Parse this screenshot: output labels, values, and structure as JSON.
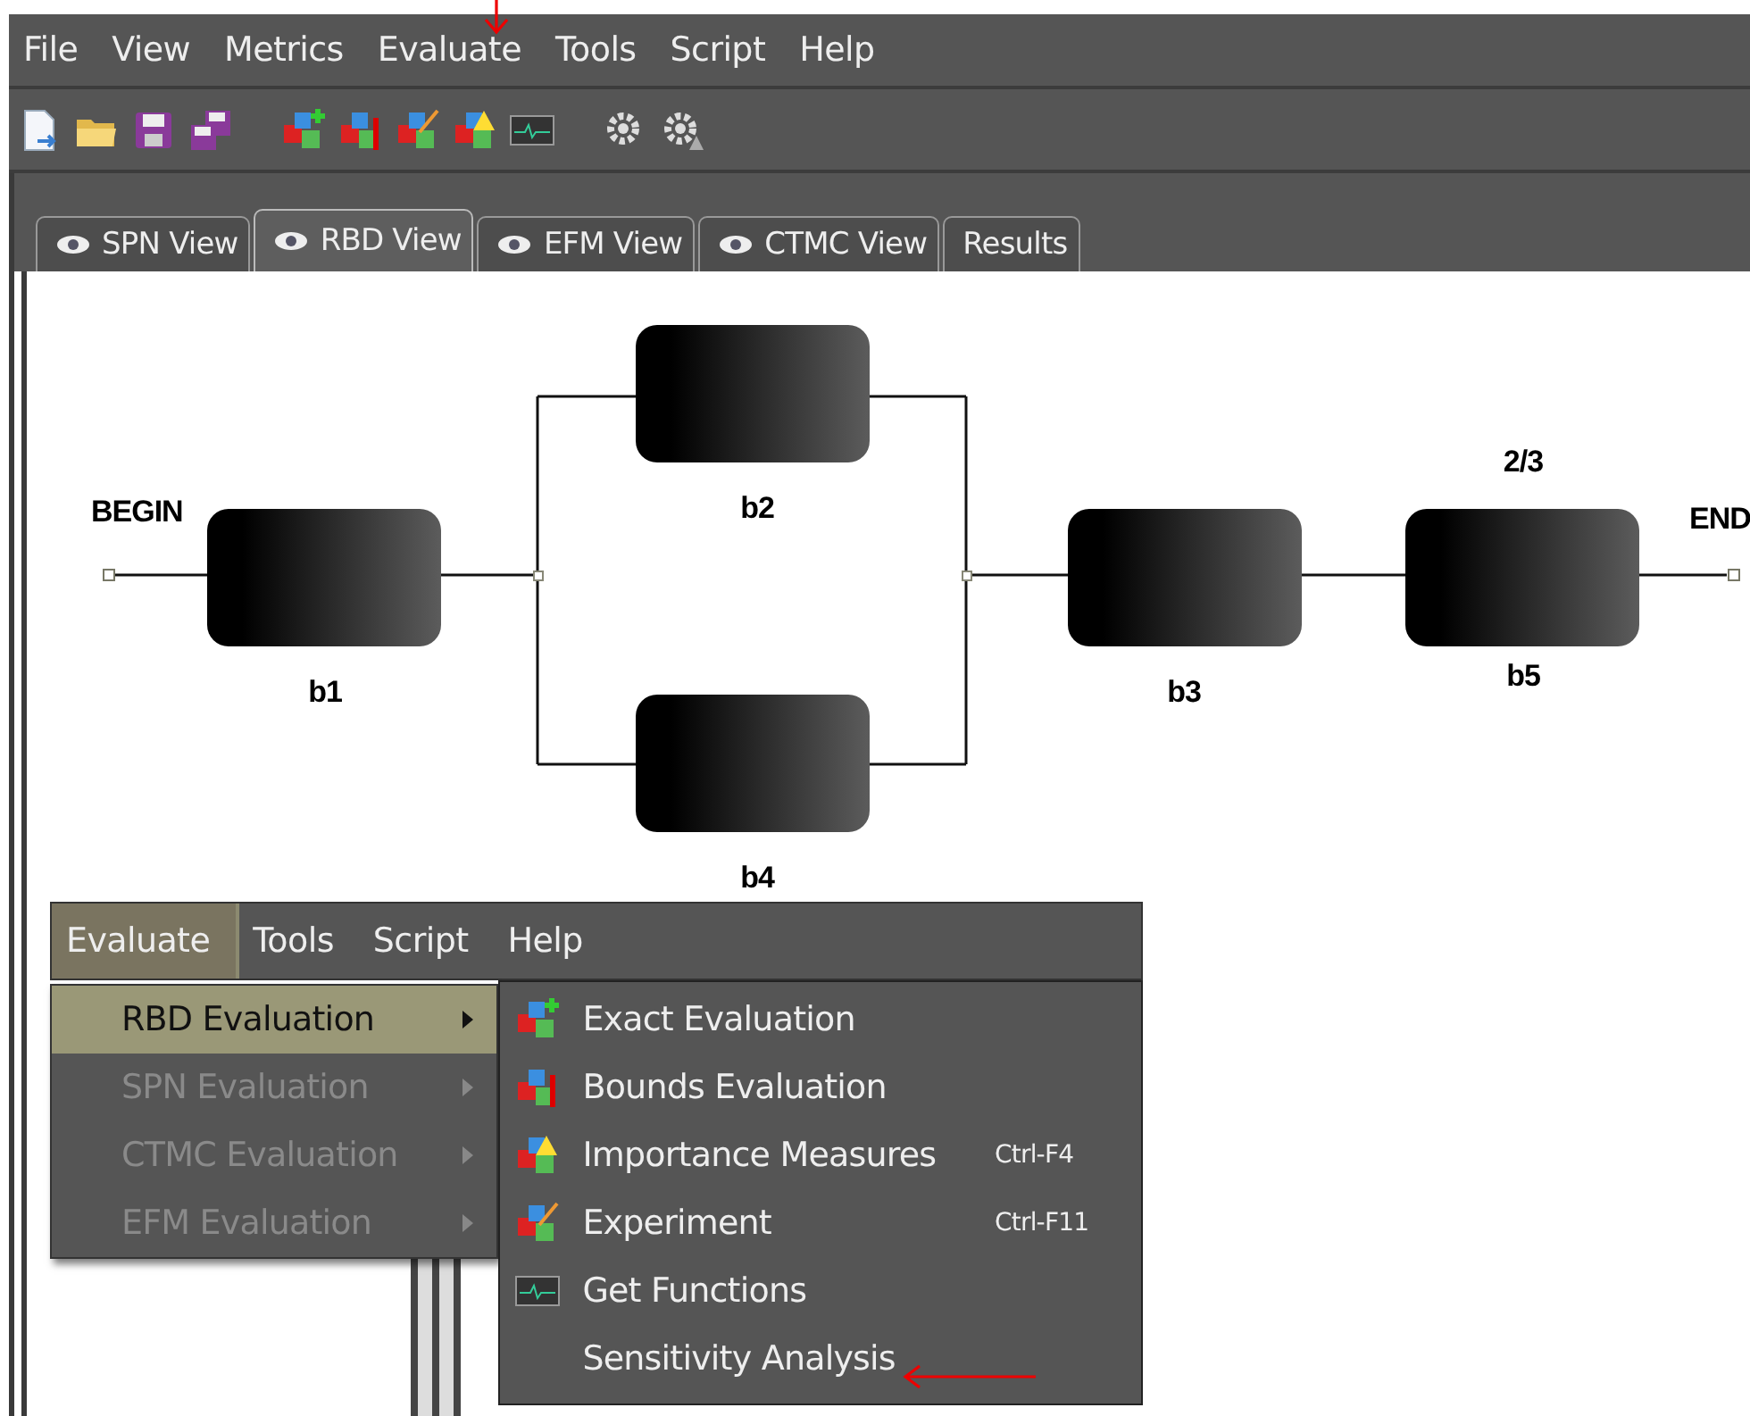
{
  "menu_bar": [
    {
      "label": "File"
    },
    {
      "label": "View"
    },
    {
      "label": "Metrics"
    },
    {
      "label": "Evaluate"
    },
    {
      "label": "Tools"
    },
    {
      "label": "Script"
    },
    {
      "label": "Help"
    }
  ],
  "tabs": [
    {
      "label": "SPN View",
      "selected": false,
      "eye": true
    },
    {
      "label": "RBD View",
      "selected": true,
      "eye": true
    },
    {
      "label": "EFM View",
      "selected": false,
      "eye": true
    },
    {
      "label": "CTMC View",
      "selected": false,
      "eye": true
    },
    {
      "label": "Results",
      "selected": false,
      "eye": false
    }
  ],
  "diagram": {
    "begin": "BEGIN",
    "end": "END",
    "blocks": [
      {
        "label": "b1"
      },
      {
        "label": "b2"
      },
      {
        "label": "b4"
      },
      {
        "label": "b3"
      },
      {
        "label": "b5",
        "vote": "2/3"
      }
    ]
  },
  "popup": {
    "menu_bar": [
      {
        "label": "Evaluate",
        "selected": true
      },
      {
        "label": "Tools",
        "selected": false
      },
      {
        "label": "Script",
        "selected": false
      },
      {
        "label": "Help",
        "selected": false
      }
    ],
    "submenu": [
      {
        "label": "RBD Evaluation",
        "selected": true,
        "disabled": false
      },
      {
        "label": "SPN Evaluation",
        "selected": false,
        "disabled": true
      },
      {
        "label": "CTMC Evaluation",
        "selected": false,
        "disabled": true
      },
      {
        "label": "EFM Evaluation",
        "selected": false,
        "disabled": true
      }
    ],
    "items": [
      {
        "kind": "exact",
        "label": "Exact Evaluation"
      },
      {
        "kind": "bounds",
        "label": "Bounds Evaluation"
      },
      {
        "kind": "importance",
        "label": "Importance Measures",
        "shortcut": "Ctrl-F4"
      },
      {
        "kind": "experiment",
        "label": "Experiment",
        "shortcut": "Ctrl-F11"
      },
      {
        "kind": "functions",
        "label": "Get Functions"
      },
      {
        "kind": "plain",
        "label": "Sensitivity Analysis"
      }
    ]
  }
}
